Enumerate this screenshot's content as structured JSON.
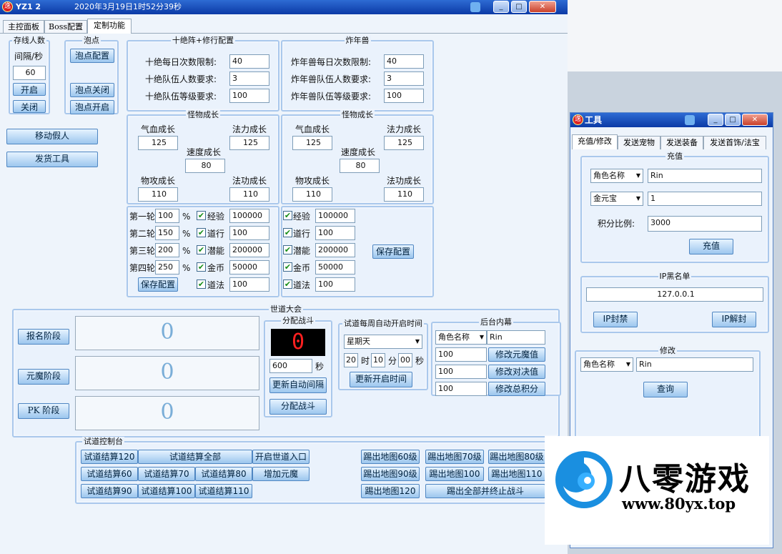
{
  "main": {
    "title": "YZ1 2",
    "datetime": "2020年3月19日1时52分39秒",
    "tabs": [
      "主控面板",
      "Boss配置",
      "定制功能"
    ],
    "online": {
      "legend": "存线人数",
      "interval_label": "间隔/秒",
      "interval_value": "60",
      "start": "开启",
      "close": "关闭"
    },
    "bubble": {
      "legend": "泡点",
      "config": "泡点配置",
      "off": "泡点关闭",
      "on": "泡点开启"
    },
    "move_fake": "移动假人",
    "send_tool": "发货工具",
    "tenjue": {
      "legend": "十绝阵+修行配置",
      "rows": [
        {
          "label": "十绝每日次数限制:",
          "value": "40"
        },
        {
          "label": "十绝队伍人数要求:",
          "value": "3"
        },
        {
          "label": "十绝队伍等级要求:",
          "value": "100"
        }
      ]
    },
    "nian": {
      "legend": "炸年兽",
      "rows": [
        {
          "label": "炸年兽每日次数限制:",
          "value": "40"
        },
        {
          "label": "炸年兽队伍人数要求:",
          "value": "3"
        },
        {
          "label": "炸年兽队伍等级要求:",
          "value": "100"
        }
      ]
    },
    "growth_left": {
      "legend": "怪物成长",
      "hp": "气血成长",
      "hp_v": "125",
      "mp": "法力成长",
      "mp_v": "125",
      "spd": "速度成长",
      "spd_v": "80",
      "atk": "物攻成长",
      "atk_v": "110",
      "matk": "法功成长",
      "matk_v": "110"
    },
    "growth_right": {
      "legend": "怪物成长",
      "hp": "气血成长",
      "hp_v": "125",
      "mp": "法力成长",
      "mp_v": "125",
      "spd": "速度成长",
      "spd_v": "80",
      "atk": "物攻成长",
      "atk_v": "110",
      "matk": "法功成长",
      "matk_v": "110"
    },
    "rounds": {
      "pct": "%",
      "rows": [
        {
          "round": "第一轮",
          "pct": "100",
          "reward": "经验",
          "amount": "100000"
        },
        {
          "round": "第二轮",
          "pct": "150",
          "reward": "道行",
          "amount": "100"
        },
        {
          "round": "第三轮",
          "pct": "200",
          "reward": "潜能",
          "amount": "200000"
        },
        {
          "round": "第四轮",
          "pct": "250",
          "reward": "金币",
          "amount": "50000"
        },
        {
          "round": "",
          "pct": "",
          "reward": "道法",
          "amount": "100"
        }
      ],
      "save": "保存配置"
    },
    "rewards_right": {
      "rows": [
        {
          "reward": "经验",
          "amount": "100000"
        },
        {
          "reward": "道行",
          "amount": "100"
        },
        {
          "reward": "潜能",
          "amount": "200000"
        },
        {
          "reward": "金币",
          "amount": "50000"
        },
        {
          "reward": "道法",
          "amount": "100"
        }
      ],
      "save": "保存配置"
    },
    "tournament": {
      "legend": "世道大会",
      "stages": [
        "报名阶段",
        "元魔阶段",
        "PK 阶段"
      ],
      "counts": [
        "0",
        "0",
        "0"
      ]
    },
    "fight": {
      "legend": "分配战斗",
      "led": "0",
      "seconds": "600",
      "sec_unit": "秒",
      "update_interval": "更新自动间隔",
      "assign": "分配战斗"
    },
    "weekly": {
      "legend": "试道每周自动开启时间",
      "day": "星期天",
      "hour": "20",
      "h": "时",
      "minute": "10",
      "m": "分",
      "second": "00",
      "s": "秒",
      "update": "更新开启时间"
    },
    "backstage": {
      "legend": "后台内幕",
      "select": "角色名称",
      "name": "Rin",
      "rows": [
        {
          "value": "100",
          "btn": "修改元魔值"
        },
        {
          "value": "100",
          "btn": "修改对决值"
        },
        {
          "value": "100",
          "btn": "修改总积分"
        }
      ]
    },
    "console": {
      "legend": "试道控制台",
      "b": [
        "试道结算120",
        "试道结算全部",
        "开启世道入口",
        "试道结算60",
        "试道结算70",
        "试道结算80",
        "增加元魔",
        "试道结算90",
        "试道结算100",
        "试道结算110"
      ],
      "kick": [
        "踢出地图60级",
        "踢出地图70级",
        "踢出地图80级",
        "踢出地图90级",
        "踢出地图100",
        "踢出地图110",
        "踢出地图120",
        "踢出全部并终止战斗"
      ]
    }
  },
  "tool": {
    "title": "工具",
    "tabs": [
      "充值/修改",
      "发送宠物",
      "发送装备",
      "发送首饰/法宝"
    ],
    "recharge": {
      "legend": "充值",
      "select1": "角色名称",
      "name": "Rin",
      "select2": "金元宝",
      "amount": "1",
      "ratio_label": "积分比例:",
      "ratio": "3000",
      "btn": "充值"
    },
    "ip": {
      "legend": "IP黑名单",
      "ip": "127.0.0.1",
      "ban": "IP封禁",
      "unban": "IP解封"
    },
    "modify": {
      "legend": "修改",
      "select": "角色名称",
      "name": "Rin",
      "query": "查询"
    }
  },
  "watermark": {
    "brand": "八零游戏",
    "url": "www.80yx.top"
  },
  "colors": {
    "title_bar": "#0b3aa6",
    "panel": "#eaf2fc",
    "button": "#9cc6ee",
    "led_digit": "#ff2020"
  }
}
